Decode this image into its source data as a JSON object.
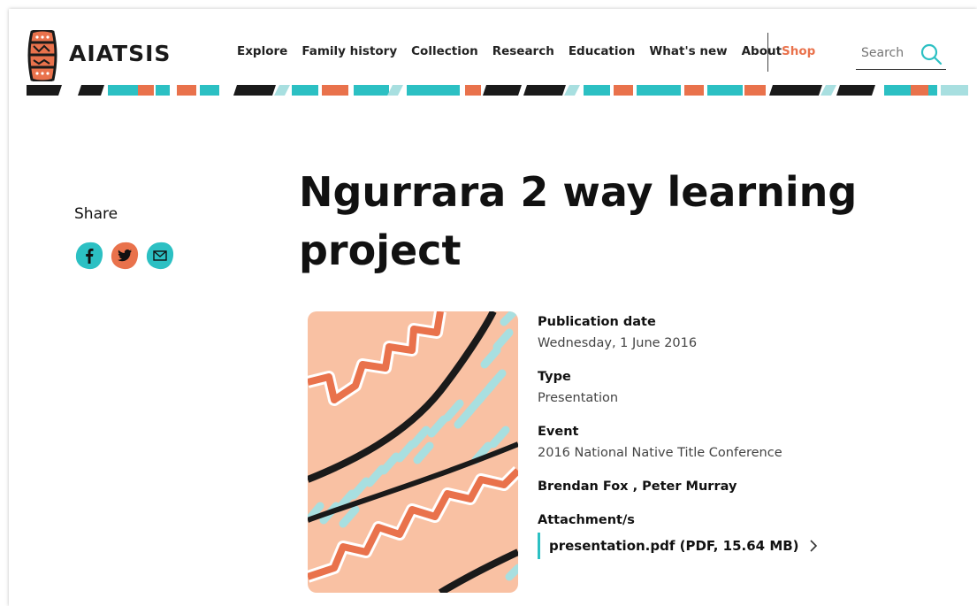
{
  "header": {
    "brand": "AIATSIS",
    "nav": [
      "Explore",
      "Family history",
      "Collection",
      "Research",
      "Education",
      "What's new",
      "About"
    ],
    "shop": "Shop",
    "search_placeholder": "Search"
  },
  "share": {
    "label": "Share",
    "icons": [
      "facebook-icon",
      "twitter-icon",
      "email-icon"
    ]
  },
  "page": {
    "title": "Ngurrara 2 way learning project"
  },
  "meta": {
    "publication_date_label": "Publication date",
    "publication_date": "Wednesday, 1 June 2016",
    "type_label": "Type",
    "type": "Presentation",
    "event_label": "Event",
    "event": "2016 National Native Title Conference",
    "authors": "Brendan Fox , Peter Murray",
    "attachments_label": "Attachment/s",
    "attachment": "presentation.pdf (PDF, 15.64 MB)"
  },
  "colors": {
    "teal": "#2cc0c3",
    "orange": "#e9724c",
    "peach": "#f9c1a3",
    "dark": "#1a1a1a"
  }
}
